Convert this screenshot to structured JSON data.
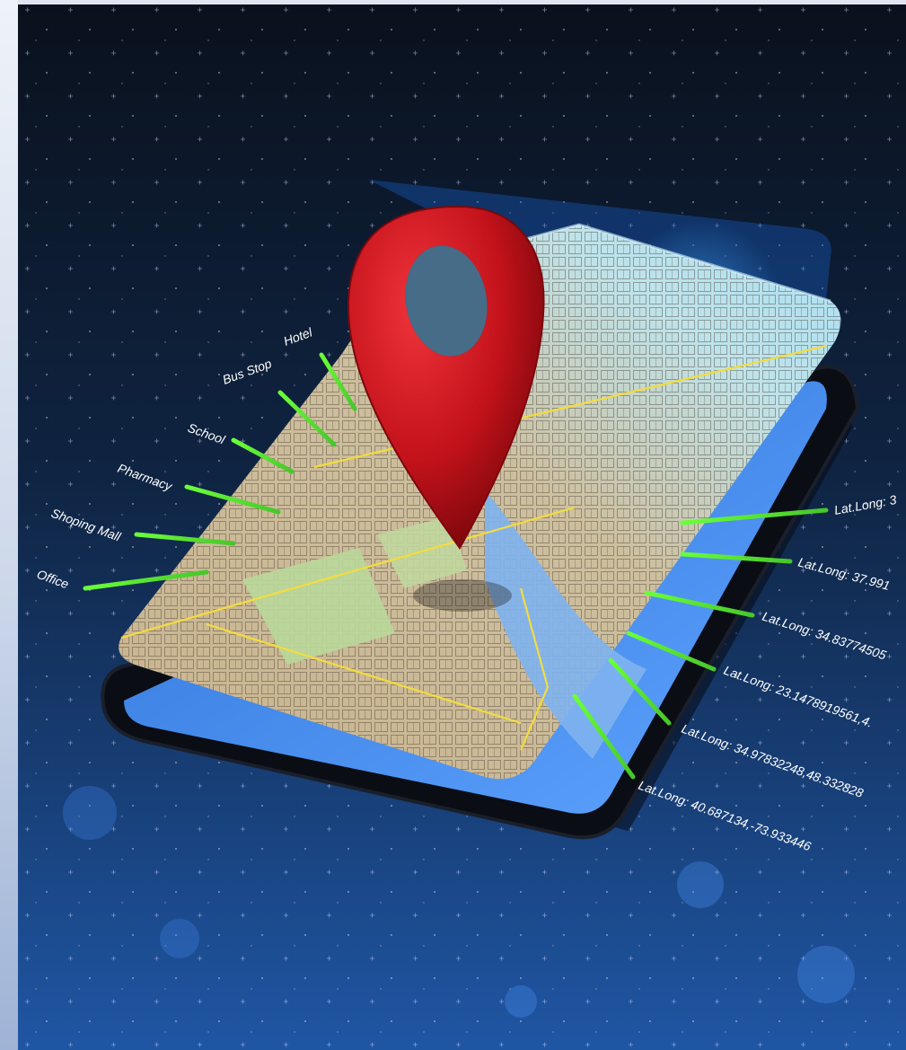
{
  "scene": {
    "description_icon": "map-pin-icon",
    "colors": {
      "pin": "#c4121a",
      "connector": "#5de03a",
      "background_top": "#0b1220",
      "background_bottom": "#1d4f9c"
    }
  },
  "left_labels": [
    "Hotel",
    "Bus Stop",
    "School",
    "Pharmacy",
    "Shoping Mall",
    "Office"
  ],
  "right_labels": [
    "Lat.Long: 3",
    "Lat.Long: 37.991",
    "Lat.Long: 34.83774505",
    "Lat.Long: 23.1478919561,4.",
    "Lat.Long: 34.97832248,48.332828",
    "Lat.Long: 40.687134,-73.933446"
  ]
}
